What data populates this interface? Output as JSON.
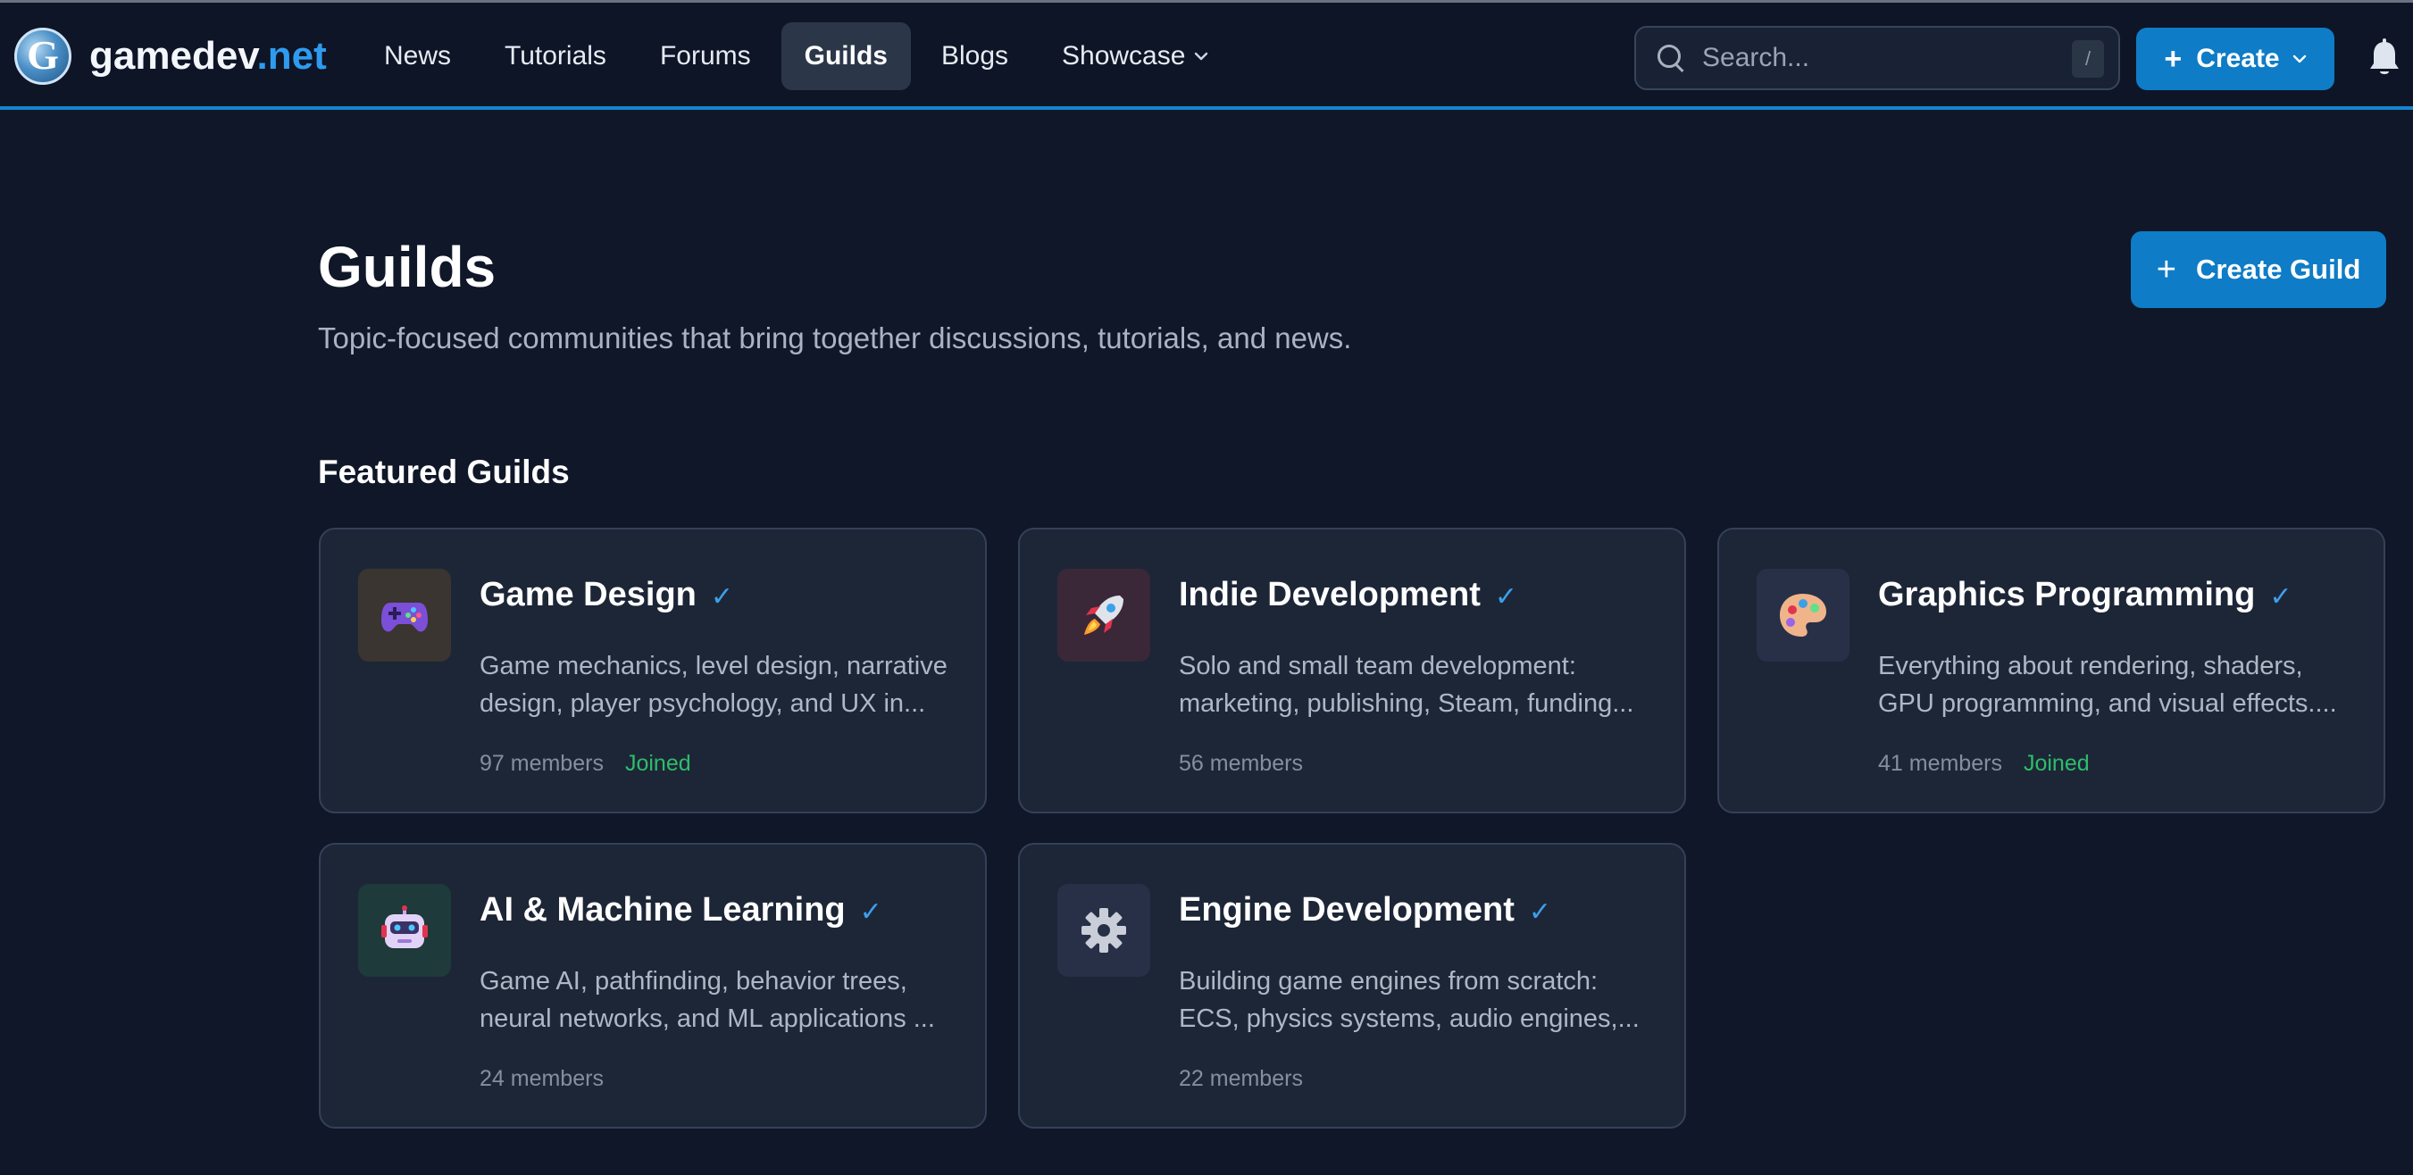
{
  "header": {
    "logo": {
      "text_main": "gamedev",
      "text_accent": ".net",
      "mark": "G"
    },
    "nav": [
      {
        "label": "News",
        "active": false
      },
      {
        "label": "Tutorials",
        "active": false
      },
      {
        "label": "Forums",
        "active": false
      },
      {
        "label": "Guilds",
        "active": true
      },
      {
        "label": "Blogs",
        "active": false
      },
      {
        "label": "Showcase",
        "active": false
      }
    ],
    "search": {
      "placeholder": "Search...",
      "shortcut": "/"
    },
    "create_label": "Create",
    "icons": {
      "search": "search-icon",
      "bell": "bell-icon",
      "chevron": "chevron-down-icon"
    }
  },
  "page": {
    "title": "Guilds",
    "subtitle": "Topic-focused communities that bring together discussions, tutorials, and news.",
    "create_guild_label": "Create Guild",
    "section_title": "Featured Guilds"
  },
  "guilds": [
    {
      "title": "Game Design",
      "desc_line1": "Game mechanics, level design, narrative",
      "desc_line2": "design, player psychology, and UX in...",
      "members": "97 members",
      "joined": "Joined",
      "icon": "gamepad-icon",
      "icon_bg": "#3a3530"
    },
    {
      "title": "Indie Development",
      "desc_line1": "Solo and small team development:",
      "desc_line2": "marketing, publishing, Steam, funding...",
      "members": "56 members",
      "joined": "",
      "icon": "rocket-icon",
      "icon_bg": "#3a2838"
    },
    {
      "title": "Graphics Programming",
      "desc_line1": "Everything about rendering, shaders,",
      "desc_line2": "GPU programming, and visual effects....",
      "members": "41 members",
      "joined": "Joined",
      "icon": "palette-icon",
      "icon_bg": "#283048"
    },
    {
      "title": "AI & Machine Learning",
      "desc_line1": "Game AI, pathfinding, behavior trees,",
      "desc_line2": "neural networks, and ML applications ...",
      "members": "24 members",
      "joined": "",
      "icon": "robot-icon",
      "icon_bg": "#1e3a3a"
    },
    {
      "title": "Engine Development",
      "desc_line1": "Building game engines from scratch:",
      "desc_line2": "ECS, physics systems, audio engines,...",
      "members": "22 members",
      "joined": "",
      "icon": "gear-icon",
      "icon_bg": "#283048"
    }
  ],
  "check_glyph": "✓"
}
